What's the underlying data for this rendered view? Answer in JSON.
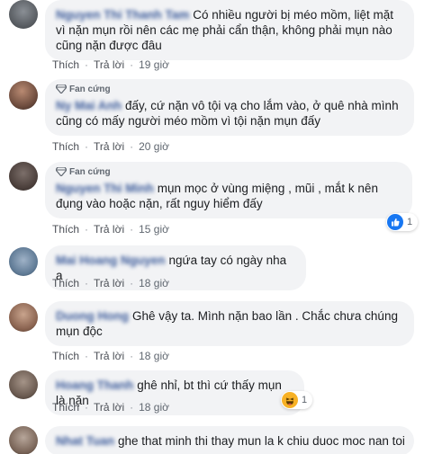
{
  "actions": {
    "like": "Thích",
    "reply": "Trả lời"
  },
  "comments": [
    {
      "author": "Nguyen Thi Thanh Tam",
      "badge": "",
      "text": "Có nhiều người bị méo mồm, liệt mặt vì nặn mụn rồi nên các mẹ phải cẩn thận, không phải mụn nào cũng nặn được đâu",
      "time": "19 giờ"
    },
    {
      "author": "Ny Mai Anh",
      "badge": "Fan cứng",
      "text": "đấy, cứ nặn vô tội vạ cho lắm vào, ở quê nhà mình cũng có mấy người méo mồm vì tội nặn mụn đấy",
      "time": "20 giờ"
    },
    {
      "author": "Nguyen Thi Minh",
      "badge": "Fan cứng",
      "text": "mụn mọc ở vùng miệng , mũi , mắt k nên đụng vào hoặc nặn, rất nguy hiểm đấy",
      "time": "15 giờ",
      "reaction": {
        "icon": "like-icon",
        "count": "1",
        "color": "#1877f2"
      }
    },
    {
      "author": "Mai Hoang Nguyen",
      "badge": "",
      "text": "ngứa tay có ngày nha a",
      "time": "18 giờ"
    },
    {
      "author": "Duong Hong",
      "badge": "",
      "text": "Ghê vậy ta. Mình nặn bao lần . Chắc chưa chúng mụn độc",
      "time": "18 giờ"
    },
    {
      "author": "Hoang Thanh",
      "badge": "",
      "text": "ghê nhỉ, bt thì cứ thấy mụn là nặn",
      "time": "18 giờ",
      "reaction": {
        "icon": "haha-icon",
        "count": "1",
        "color": "#f7b125"
      }
    },
    {
      "author": "Nhat Tuan",
      "badge": "",
      "text": "ghe that minh thi thay mun la k chiu duoc moc nan toi",
      "time": ""
    }
  ]
}
